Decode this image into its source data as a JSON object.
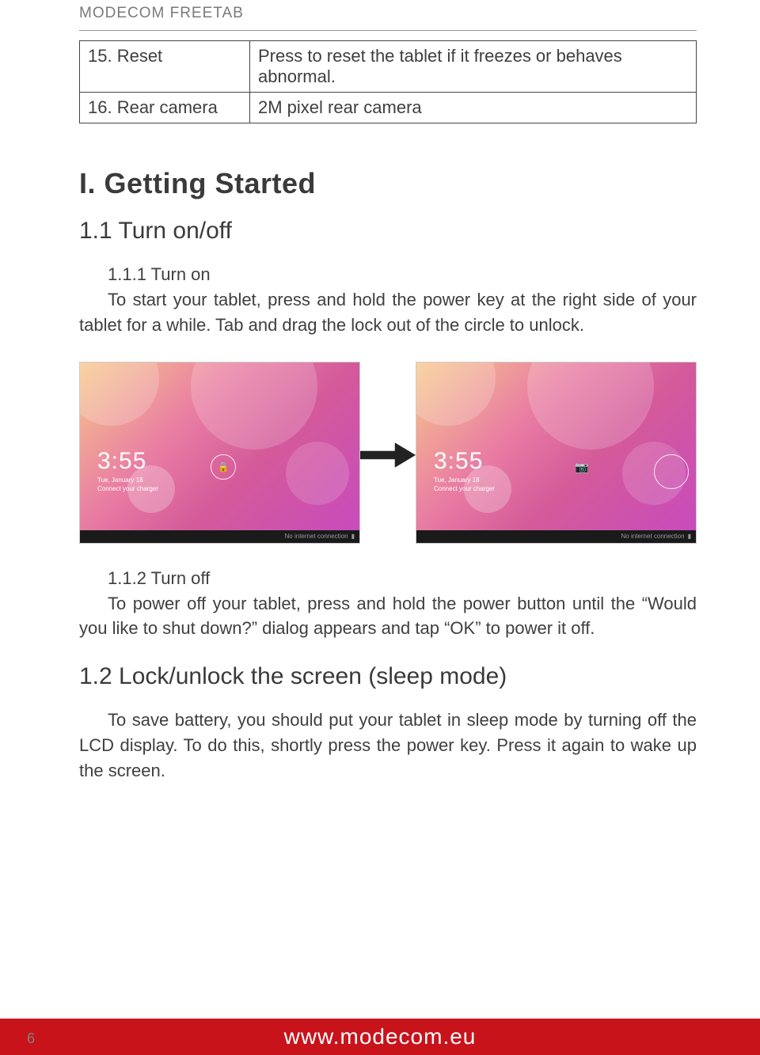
{
  "header": {
    "brand": "MODECOM FREETAB"
  },
  "spec_table": {
    "rows": [
      {
        "label": "15. Reset",
        "desc": "Press to reset the tablet if it freezes or be­haves abnormal."
      },
      {
        "label": "16. Rear camera",
        "desc": "2M pixel rear camera"
      }
    ]
  },
  "section1": {
    "heading": "I. Getting Started",
    "sub1_title": "1.1 Turn on/off",
    "p111_title": "1.1.1 Turn on",
    "p111_body": "To start your tablet, press and hold the power key at the right side of your tablet for a while. Tab and drag the lock out of the circle to unlock.",
    "p112_title": "1.1.2 Turn off",
    "p112_body": "To power off your tablet, press and hold the power button until the “Would you like to shut down?” dialog appears and tap “OK” to power it off.",
    "sub2_title": "1.2 Lock/unlock the screen (sleep mode)",
    "sub2_body": "To save battery, you should put your tablet in sleep mode by turning off the LCD display. To do this, shortly press the power key. Press it again to wake up the screen."
  },
  "lockscreen": {
    "time": "3:55",
    "date": "Tue, January 18",
    "sub": "Connect your charger",
    "status": "No internet connection"
  },
  "footer": {
    "url": "www.modecom.eu",
    "page": "6"
  }
}
